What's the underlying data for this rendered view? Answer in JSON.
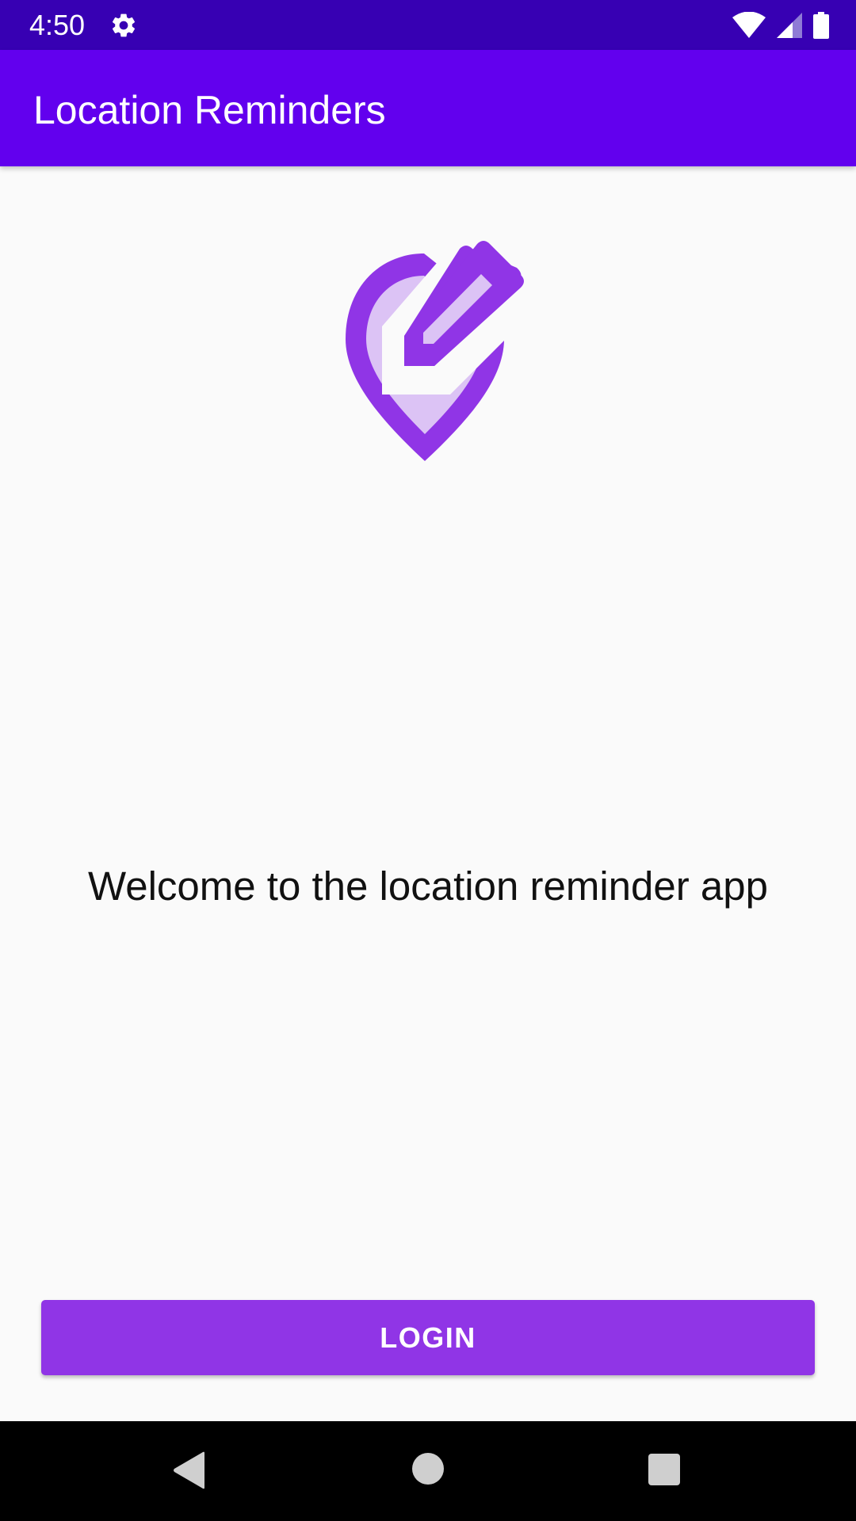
{
  "status_bar": {
    "time": "4:50",
    "icons": [
      "gear-icon",
      "wifi-icon",
      "cellular-signal-icon",
      "battery-icon"
    ]
  },
  "app_bar": {
    "title": "Location Reminders"
  },
  "logo": {
    "icon": "location-pin-edit-logo",
    "colors": {
      "primary": "#9035E6",
      "light": "#DCC3F5"
    }
  },
  "main": {
    "welcome_text": "Welcome to the location reminder app"
  },
  "login_button": {
    "label": "LOGIN"
  },
  "nav_bar": {
    "icons": [
      "back-icon",
      "home-icon",
      "recents-icon"
    ]
  },
  "colors": {
    "status_bar": "#3700B3",
    "app_bar": "#6200EE",
    "button": "#9035E6",
    "background": "#FAFAFA"
  }
}
